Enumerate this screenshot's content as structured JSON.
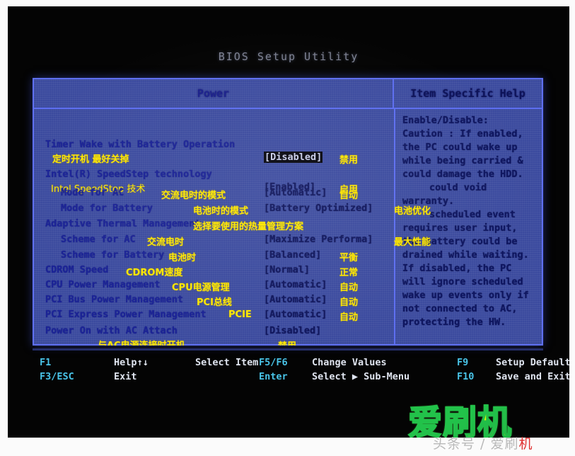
{
  "window": {
    "bios_title": "BIOS Setup Utility",
    "tab_title": "Power",
    "help_title": "Item Specific Help"
  },
  "settings": [
    {
      "label": "Timer Wake with Battery Operation",
      "label_cn": "定时开机    最好关掉",
      "value": "[Disabled]",
      "value_cn": "禁用",
      "selected": true,
      "indent": 0
    },
    {
      "label": "Intel(R) SpeedStep technology",
      "label_cn": "Intel SpeedStep 技术",
      "value": "[Enabled]",
      "value_cn": "启用",
      "selected": false,
      "indent": 0
    },
    {
      "label": "Mode for AC",
      "label_cn": "交流电时的模式",
      "value": "[Automatic]",
      "value_cn": "自动",
      "selected": false,
      "indent": 2
    },
    {
      "label": "Mode for Battery",
      "label_cn": "电池时的模式",
      "value": "[Battery Optimized]",
      "value_cn": "电池优化",
      "selected": false,
      "indent": 2
    },
    {
      "label": "Adaptive Thermal Management",
      "label_cn": "选择要使用的热量管理方案",
      "value": "",
      "value_cn": "",
      "selected": false,
      "indent": 0
    },
    {
      "label": "Scheme for AC",
      "label_cn": "交流电时",
      "value": "[Maximize Performa]",
      "value_cn": "最大性能",
      "selected": false,
      "indent": 2
    },
    {
      "label": "Scheme for Battery",
      "label_cn": "电池时",
      "value": "[Balanced]",
      "value_cn": "平衡",
      "selected": false,
      "indent": 2
    },
    {
      "label": "CDROM Speed",
      "label_cn": "CDROM速度",
      "value": "[Normal]",
      "value_cn": "正常",
      "selected": false,
      "indent": 0
    },
    {
      "label": "CPU Power Management",
      "label_cn": "CPU电源管理",
      "value": "[Automatic]",
      "value_cn": "自动",
      "selected": false,
      "indent": 0
    },
    {
      "label": "PCI Bus Power Management",
      "label_cn": "PCI总线",
      "value": "[Automatic]",
      "value_cn": "自动",
      "selected": false,
      "indent": 0
    },
    {
      "label": "PCI Express Power Management",
      "label_cn": "PCIE",
      "value": "[Automatic]",
      "value_cn": "自动",
      "selected": false,
      "indent": 0
    },
    {
      "label": "Power On with AC Attach",
      "label_cn": "与AC电源连接时开机",
      "value": "[Disabled]",
      "value_cn": "禁用",
      "selected": false,
      "indent": 0
    }
  ],
  "help_lines": [
    "Enable/Disable:",
    "Caution : If enabled,",
    "the PC could wake up",
    "while being carried &",
    "could damage the HDD.",
    "could void",
    "warranty.",
    "scheduled event",
    "requires user  input,",
    "the battery could be",
    "drained while waiting.",
    "If disabled, the PC",
    "will ignore scheduled",
    "wake up events only if",
    "not connected to AC,",
    "protecting the HW."
  ],
  "function_keys": [
    {
      "key": "F1",
      "desc": "Help↑↓"
    },
    {
      "key": "F3/ESC",
      "desc": "Exit"
    },
    {
      "key": "",
      "desc": "Select Item"
    },
    {
      "key": "F5/F6",
      "desc": "Change Values"
    },
    {
      "key": "Enter",
      "desc": "Select ▶ Sub-Menu"
    },
    {
      "key": "F9",
      "desc": "Setup Defaults"
    },
    {
      "key": "F10",
      "desc": "Save and Exit"
    }
  ],
  "watermark": {
    "logo": "爱刷机",
    "credit_left": "头条号 / 爱刷",
    "credit_mark": "机"
  },
  "colors": {
    "panel_bg": "#3b4a9e",
    "panel_border": "#5e6ff0",
    "label_blue": "#1b2397",
    "annotation_yellow": "#ffe800",
    "fn_key_cyan": "#49c4e8",
    "watermark_green": "#22c24a"
  }
}
